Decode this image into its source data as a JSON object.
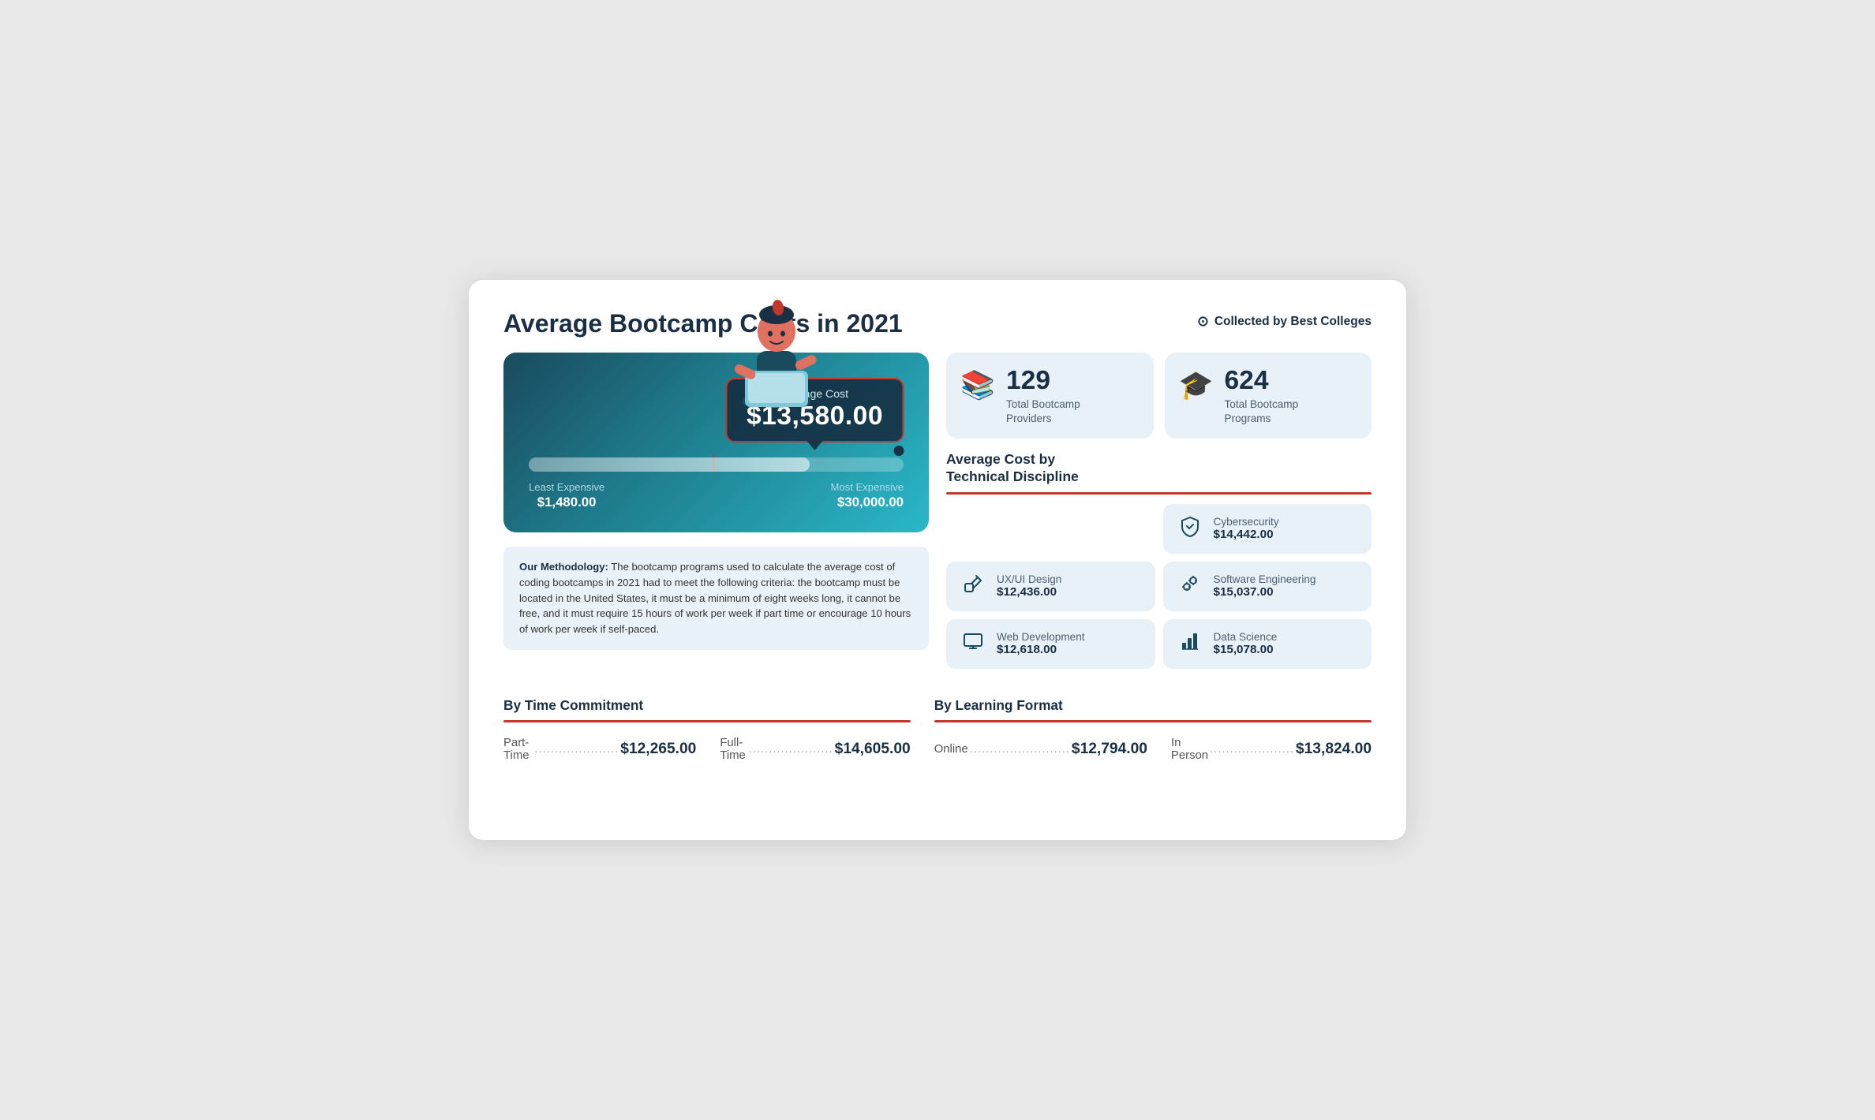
{
  "header": {
    "title": "Average Bootcamp Costs in 2021",
    "collected_by": "Collected by Best Colleges"
  },
  "cost_card": {
    "label": "Average Cost",
    "average": "$13,580.00",
    "least_label": "Least Expensive",
    "least_value": "$1,480.00",
    "most_label": "Most Expensive",
    "most_value": "$30,000.00"
  },
  "methodology": {
    "bold": "Our Methodology:",
    "text": " The bootcamp programs used to calculate the average cost of coding bootcamps in 2021 had to meet the following criteria: the bootcamp must be located in the United States, it must be a minimum of eight weeks long, it cannot be free, and it must require 15 hours of work per week if part time or encourage 10 hours of work per week if self-paced."
  },
  "stats": [
    {
      "icon": "📚",
      "number": "129",
      "label": "Total Bootcamp\nProviders"
    },
    {
      "icon": "🎓",
      "number": "624",
      "label": "Total Bootcamp\nPrograms"
    }
  ],
  "discipline": {
    "title": "Average Cost by\nTechnical Discipline",
    "items": [
      {
        "icon": "🛡",
        "name": "Cybersecurity",
        "cost": "$14,442.00",
        "span": true
      },
      {
        "icon": "✏",
        "name": "UX/UI Design",
        "cost": "$12,436.00"
      },
      {
        "icon": "⚙",
        "name": "Software Engineering",
        "cost": "$15,037.00"
      },
      {
        "icon": "🖥",
        "name": "Web Development",
        "cost": "$12,618.00"
      },
      {
        "icon": "📊",
        "name": "Data Science",
        "cost": "$15,078.00"
      }
    ]
  },
  "time_commitment": {
    "title": "By Time Commitment",
    "items": [
      {
        "label": "Part-Time",
        "dots": "...................",
        "value": "$12,265.00"
      },
      {
        "label": "Full-Time",
        "dots": "...................",
        "value": "$14,605.00"
      }
    ]
  },
  "learning_format": {
    "title": "By Learning Format",
    "items": [
      {
        "label": "Online",
        "dots": ".........................",
        "value": "$12,794.00"
      },
      {
        "label": "In Person",
        "dots": "...................",
        "value": "$13,824.00"
      }
    ]
  }
}
